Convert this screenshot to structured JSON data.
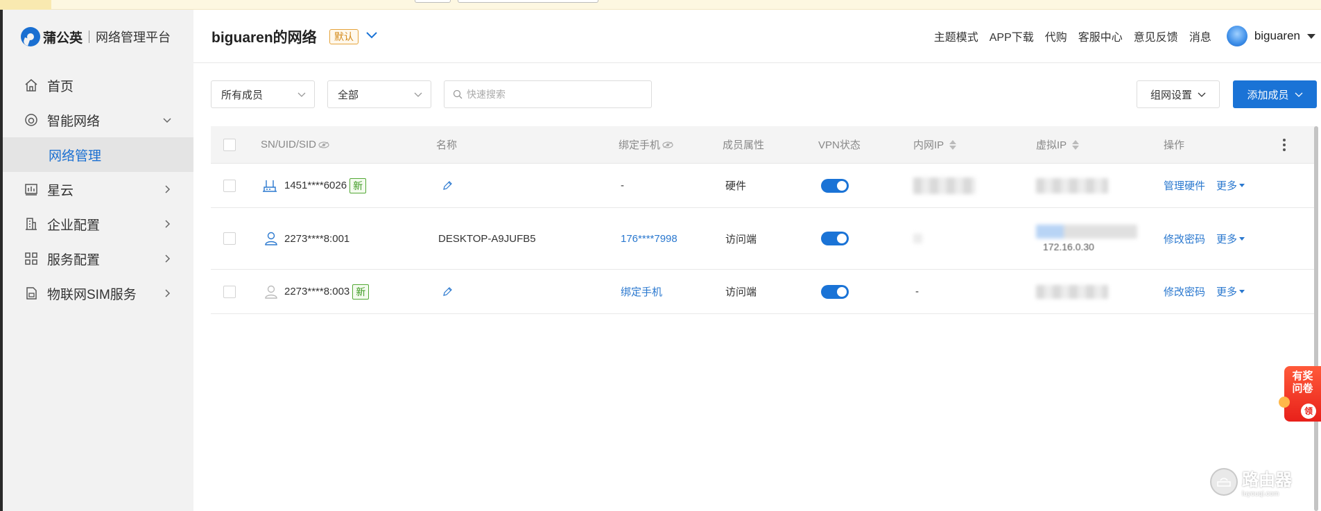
{
  "brand": {
    "name": "蒲公英",
    "platform": "网络管理平台"
  },
  "sidebar": {
    "items": [
      {
        "label": "首页"
      },
      {
        "label": "智能网络"
      },
      {
        "label": "网络管理"
      },
      {
        "label": "星云"
      },
      {
        "label": "企业配置"
      },
      {
        "label": "服务配置"
      },
      {
        "label": "物联网SIM服务"
      }
    ]
  },
  "header": {
    "network_name": "biguaren的网络",
    "default_badge": "默认",
    "links": [
      "主题模式",
      "APP下载",
      "代购",
      "客服中心",
      "意见反馈",
      "消息"
    ],
    "username": "biguaren"
  },
  "filters": {
    "member_select": "所有成员",
    "type_select": "全部",
    "search_placeholder": "快速搜索",
    "network_settings": "组网设置",
    "add_member": "添加成员"
  },
  "table": {
    "columns": [
      "SN/UID/SID",
      "名称",
      "绑定手机",
      "成员属性",
      "VPN状态",
      "内网IP",
      "虚拟IP",
      "操作"
    ],
    "rows": [
      {
        "id": "1451****6026",
        "new": "新",
        "name": "",
        "phone": "-",
        "attr": "硬件",
        "vpn": true,
        "lan_ip": "",
        "virtual_ip": "",
        "action": "管理硬件",
        "more": "更多"
      },
      {
        "id": "2273****8:001",
        "new": "",
        "name": "DESKTOP-A9JUFB5",
        "phone": "176****7998",
        "attr": "访问端",
        "vpn": true,
        "lan_ip": "",
        "virtual_ip": "172.16.0.30",
        "action": "修改密码",
        "more": "更多"
      },
      {
        "id": "2273****8:003",
        "new": "新",
        "name": "",
        "phone": "绑定手机",
        "attr": "访问端",
        "vpn": true,
        "lan_ip": "-",
        "virtual_ip": "",
        "action": "修改密码",
        "more": "更多"
      }
    ]
  },
  "survey": {
    "line1": "有奖",
    "line2": "问卷",
    "badge": "领"
  },
  "watermark": {
    "title": "路由器",
    "sub": "luyouqi.com"
  },
  "colors": {
    "accent": "#1a73d6",
    "link": "#2a78cf",
    "new_tag": "#3d9a22",
    "default_badge": "#d48a1a"
  }
}
